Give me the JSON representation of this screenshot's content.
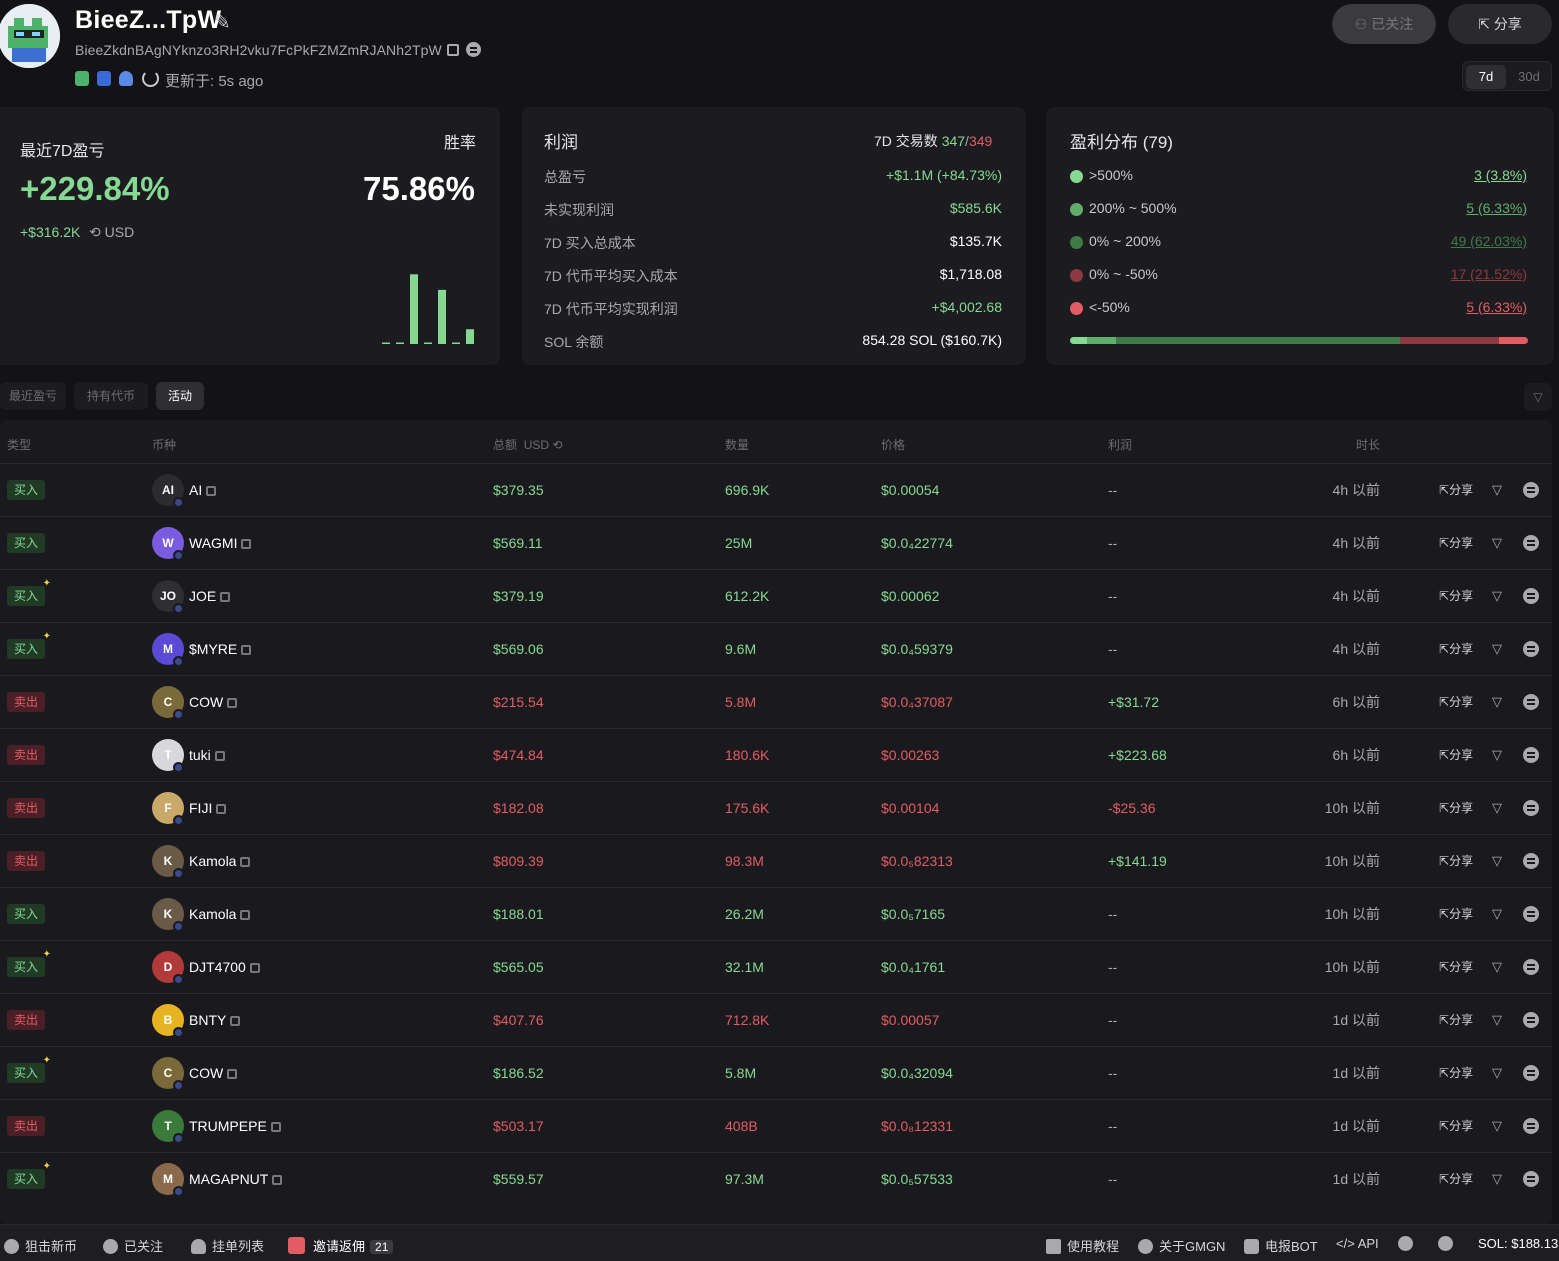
{
  "header": {
    "wallet_name": "BieeZ...TpW",
    "address": "BieeZkdnBAgNYknzo3RH2vku7FcPkFZMZmRJANh2TpW",
    "updated_label": "更新于: 5s ago",
    "follow_button": "已关注",
    "share_button": "分享",
    "periods": [
      "7d",
      "30d"
    ]
  },
  "pnl_card": {
    "title": "最近7D盈亏",
    "pnl_percent": "+229.84%",
    "pnl_usd": "+$316.2K",
    "unit": "USD",
    "winrate_label": "胜率",
    "winrate_value": "75.86%",
    "daily_bars": [
      0.01,
      0.01,
      0.85,
      0.01,
      0.66,
      0.01,
      0.18
    ]
  },
  "profit_card": {
    "title": "利润",
    "tx_label": "7D 交易数",
    "tx_buy": "347",
    "tx_sep": "/",
    "tx_sell": "349",
    "rows": [
      {
        "label": "总盈亏",
        "value": "+$1.1M (+84.73%)"
      },
      {
        "label": "未实现利润",
        "value": "$585.6K"
      },
      {
        "label": "7D 买入总成本",
        "value": "$135.7K"
      },
      {
        "label": "7D 代币平均买入成本",
        "value": "$1,718.08"
      },
      {
        "label": "7D 代币平均实现利润",
        "value": "+$4,002.68"
      },
      {
        "label": "SOL 余额",
        "value": "854.28 SOL ($160.7K)"
      }
    ]
  },
  "distribution_card": {
    "title": "盈利分布 (79)",
    "rows": [
      {
        "label": ">500%",
        "value": "3 (3.8%)",
        "color": "#86d993"
      },
      {
        "label": "200% ~ 500%",
        "value": "5 (6.33%)",
        "color": "#5fae6a"
      },
      {
        "label": "0% ~ 200%",
        "value": "49 (62.03%)",
        "color": "#3f7a49"
      },
      {
        "label": "0% ~ -50%",
        "value": "17 (21.52%)",
        "color": "#8a3a40"
      },
      {
        "label": "<-50%",
        "value": "5 (6.33%)",
        "color": "#e25d63"
      }
    ],
    "bar_fractions": [
      0.038,
      0.0633,
      0.6203,
      0.2152,
      0.0633
    ]
  },
  "tabs": [
    "最近盈亏",
    "持有代币",
    "活动"
  ],
  "table": {
    "headers": [
      "类型",
      "币种",
      "总额",
      "USD",
      "数量",
      "价格",
      "利润",
      "时长"
    ],
    "share_label": "分享",
    "rows": [
      {
        "type": "买入",
        "side": "buy",
        "new": false,
        "token": "AI",
        "icon": "AI",
        "icon_color": "#2b2b30",
        "amount": "$379.35",
        "qty": "696.9K",
        "price": "$0.00054",
        "profit": "--",
        "time": "4h 以前"
      },
      {
        "type": "买入",
        "side": "buy",
        "new": false,
        "token": "WAGMI",
        "icon": "W",
        "icon_color": "#7b5be0",
        "amount": "$569.11",
        "qty": "25M",
        "price": "$0.0₄22774",
        "profit": "--",
        "time": "4h 以前"
      },
      {
        "type": "买入",
        "side": "buy",
        "new": true,
        "token": "JOE",
        "icon": "JO",
        "icon_color": "#2e2e33",
        "amount": "$379.19",
        "qty": "612.2K",
        "price": "$0.00062",
        "profit": "--",
        "time": "4h 以前"
      },
      {
        "type": "买入",
        "side": "buy",
        "new": true,
        "token": "$MYRE",
        "icon": "M",
        "icon_color": "#5a4ad6",
        "amount": "$569.06",
        "qty": "9.6M",
        "price": "$0.0₄59379",
        "profit": "--",
        "time": "4h 以前"
      },
      {
        "type": "卖出",
        "side": "sell",
        "new": false,
        "token": "COW",
        "icon": "C",
        "icon_color": "#7a6a3a",
        "amount": "$215.54",
        "qty": "5.8M",
        "price": "$0.0₄37087",
        "profit": "+$31.72",
        "time": "6h 以前"
      },
      {
        "type": "卖出",
        "side": "sell",
        "new": false,
        "token": "tuki",
        "icon": "T",
        "icon_color": "#d8d8dc",
        "amount": "$474.84",
        "qty": "180.6K",
        "price": "$0.00263",
        "profit": "+$223.68",
        "time": "6h 以前"
      },
      {
        "type": "卖出",
        "side": "sell",
        "new": false,
        "token": "FIJI",
        "icon": "F",
        "icon_color": "#c9a86a",
        "amount": "$182.08",
        "qty": "175.6K",
        "price": "$0.00104",
        "profit": "-$25.36",
        "time": "10h 以前"
      },
      {
        "type": "卖出",
        "side": "sell",
        "new": false,
        "token": "Kamola",
        "icon": "K",
        "icon_color": "#6a5a48",
        "amount": "$809.39",
        "qty": "98.3M",
        "price": "$0.0₅82313",
        "profit": "+$141.19",
        "time": "10h 以前"
      },
      {
        "type": "买入",
        "side": "buy",
        "new": false,
        "token": "Kamola",
        "icon": "K",
        "icon_color": "#6a5a48",
        "amount": "$188.01",
        "qty": "26.2M",
        "price": "$0.0₅7165",
        "profit": "--",
        "time": "10h 以前"
      },
      {
        "type": "买入",
        "side": "buy",
        "new": true,
        "token": "DJT4700",
        "icon": "D",
        "icon_color": "#b23a3a",
        "amount": "$565.05",
        "qty": "32.1M",
        "price": "$0.0₄1761",
        "profit": "--",
        "time": "10h 以前"
      },
      {
        "type": "卖出",
        "side": "sell",
        "new": false,
        "token": "BNTY",
        "icon": "B",
        "icon_color": "#e6b422",
        "amount": "$407.76",
        "qty": "712.8K",
        "price": "$0.00057",
        "profit": "--",
        "time": "1d 以前"
      },
      {
        "type": "买入",
        "side": "buy",
        "new": true,
        "token": "COW",
        "icon": "C",
        "icon_color": "#7a6a3a",
        "amount": "$186.52",
        "qty": "5.8M",
        "price": "$0.0₄32094",
        "profit": "--",
        "time": "1d 以前"
      },
      {
        "type": "卖出",
        "side": "sell",
        "new": false,
        "token": "TRUMPEPE",
        "icon": "T",
        "icon_color": "#3a7a3a",
        "amount": "$503.17",
        "qty": "408B",
        "price": "$0.0₈12331",
        "profit": "--",
        "time": "1d 以前"
      },
      {
        "type": "买入",
        "side": "buy",
        "new": true,
        "token": "MAGAPNUT",
        "icon": "M",
        "icon_color": "#8a6a4a",
        "amount": "$559.57",
        "qty": "97.3M",
        "price": "$0.0₅57533",
        "profit": "--",
        "time": "1d 以前"
      }
    ]
  },
  "footer": {
    "left": [
      {
        "label": "狙击新币",
        "icon": "crosshair-icon"
      },
      {
        "label": "已关注",
        "icon": "user-icon"
      },
      {
        "label": "挂单列表",
        "icon": "bell-icon"
      },
      {
        "label": "邀请返佣",
        "icon": "gift-icon",
        "count": "21"
      }
    ],
    "right": [
      {
        "label": "使用教程",
        "icon": "graduation-cap-icon"
      },
      {
        "label": "关于GMGN",
        "icon": "globe-icon"
      },
      {
        "label": "电报BOT",
        "icon": "bot-icon"
      },
      {
        "label": "API",
        "icon": "code-icon"
      }
    ],
    "sol_price": "SOL: $188.13"
  },
  "colors": {
    "background": "#131316",
    "card": "#1c1c20",
    "positive": "#86d993",
    "negative": "#e25d63"
  }
}
